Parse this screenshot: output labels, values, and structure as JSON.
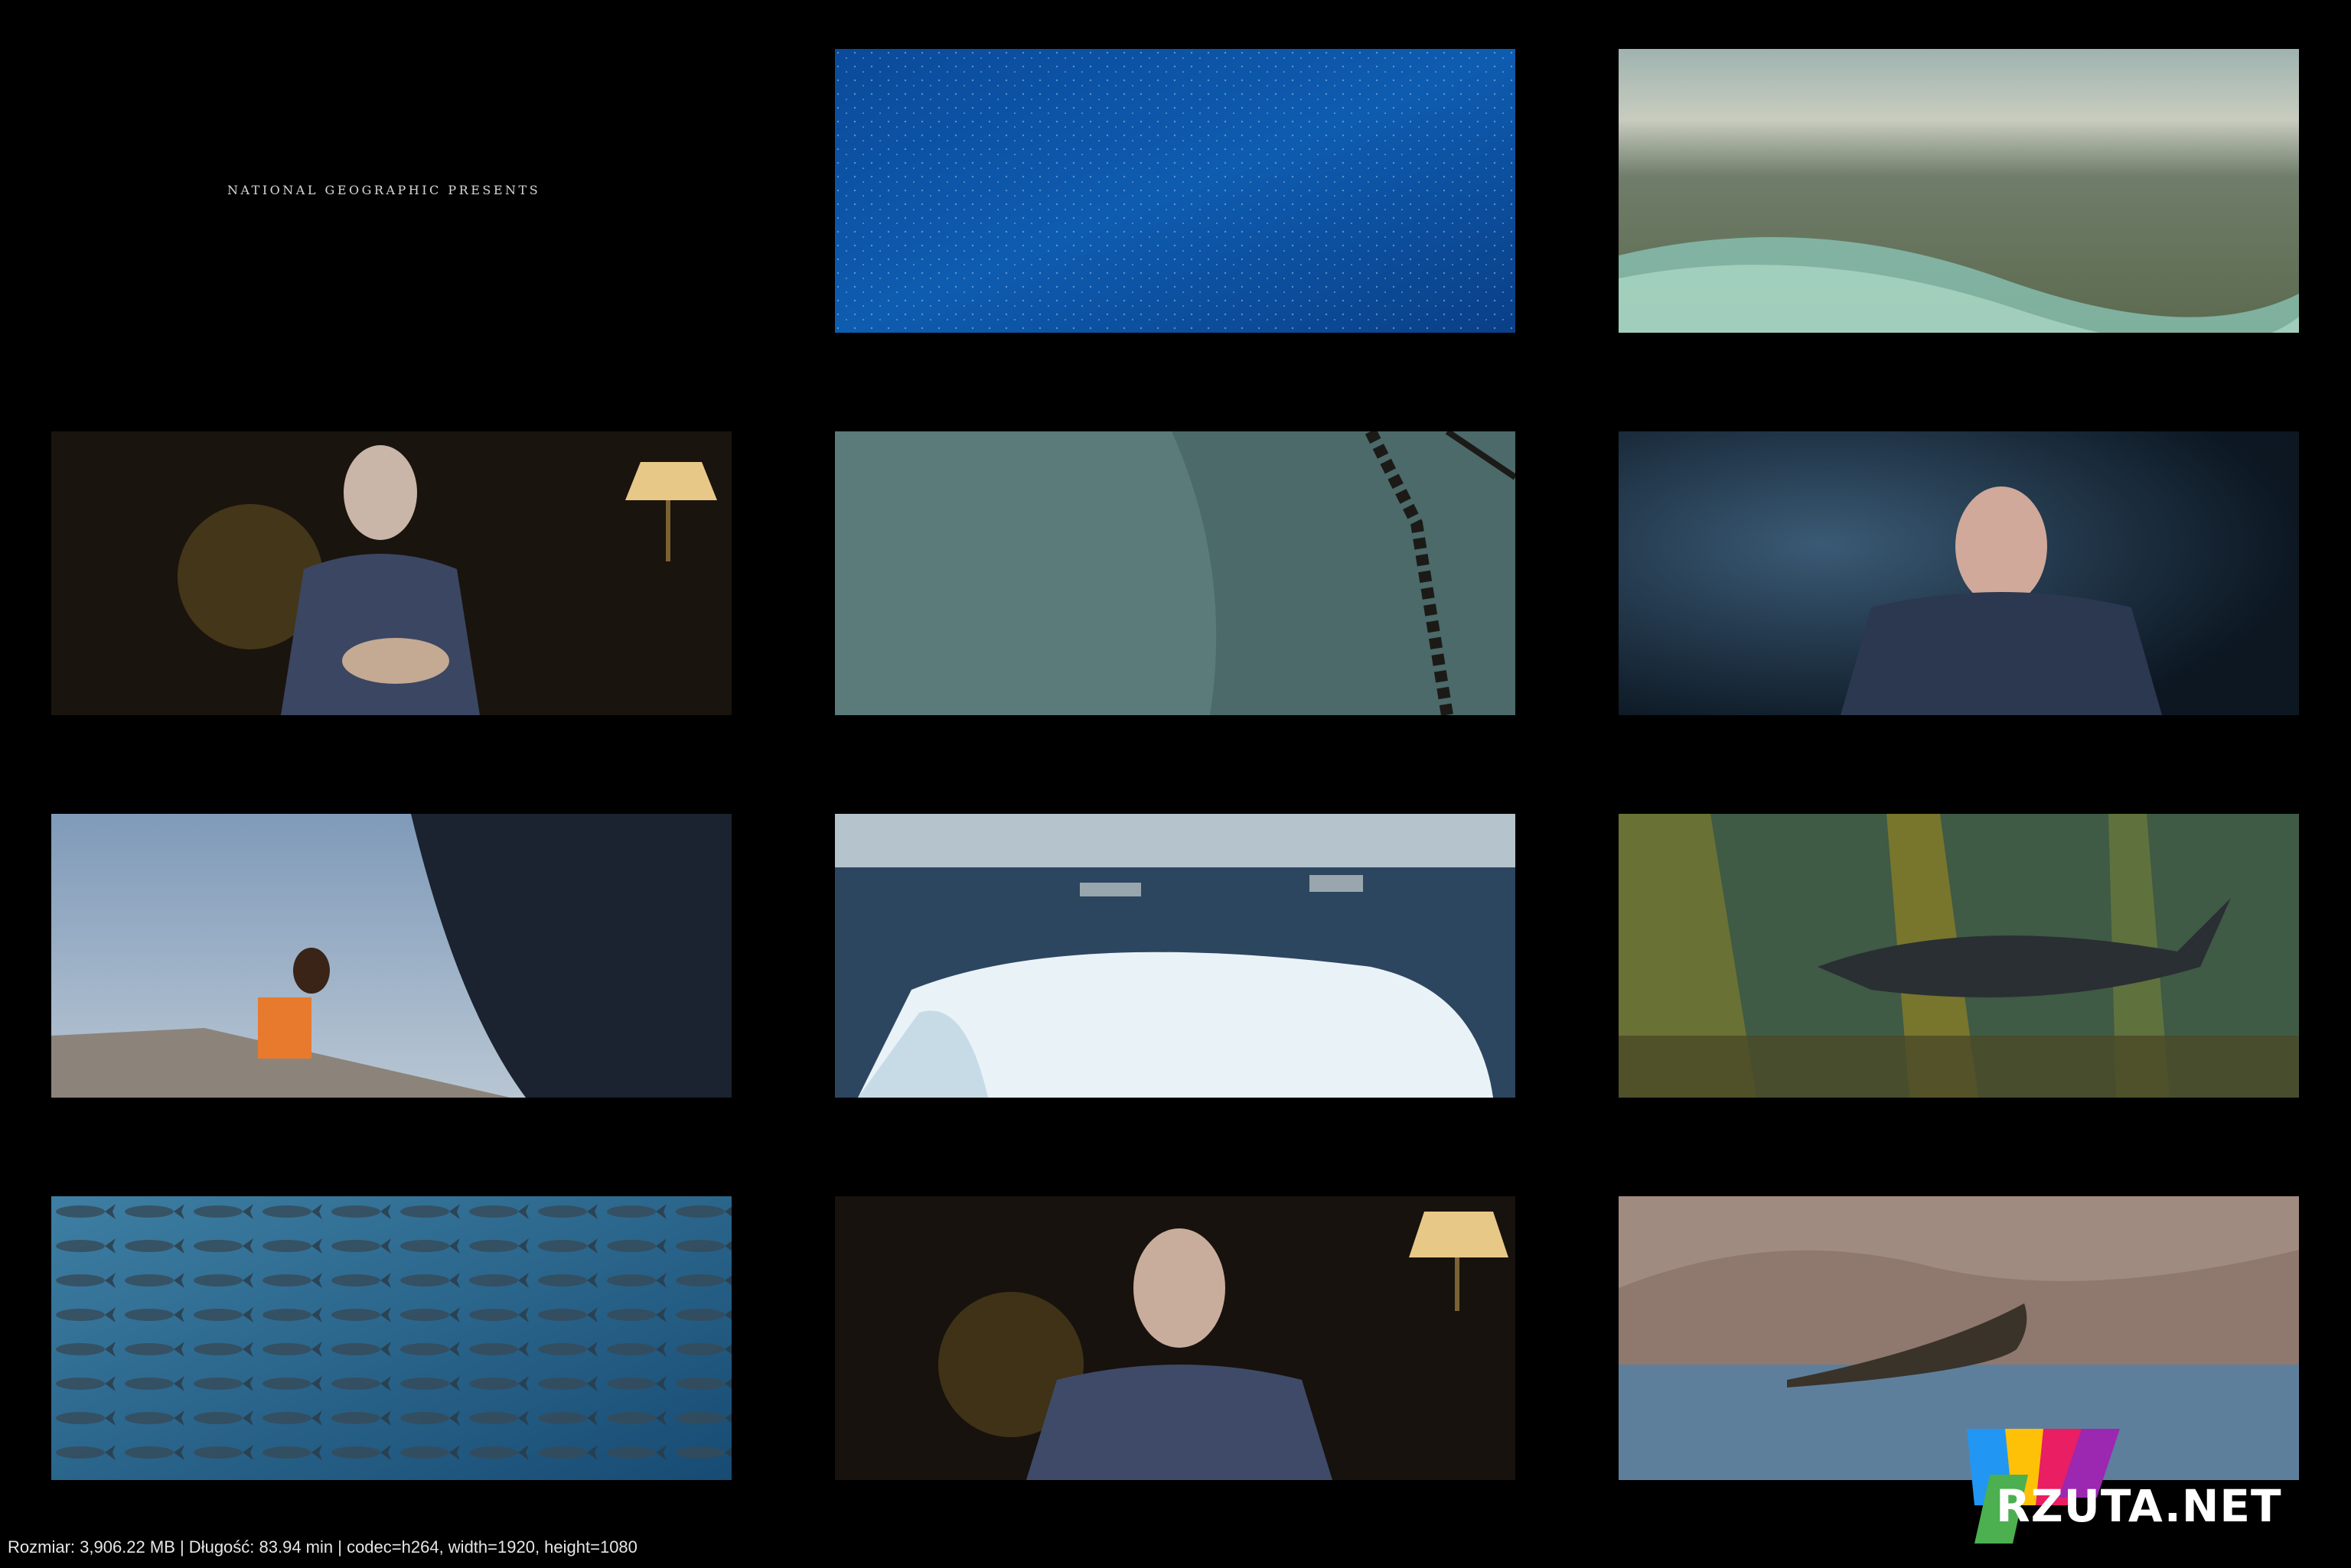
{
  "title_card": {
    "text": "NATIONAL GEOGRAPHIC PRESENTS"
  },
  "thumbnails": [
    {
      "id": "title-card"
    },
    {
      "id": "open-ocean-fish-school"
    },
    {
      "id": "shallow-reef-horizon"
    },
    {
      "id": "narrator-study-globe"
    },
    {
      "id": "seabed-trawl-net"
    },
    {
      "id": "narrator-dark-blue"
    },
    {
      "id": "fisherman-boat-ship"
    },
    {
      "id": "iceberg-penguins-trawlers"
    },
    {
      "id": "kelp-forest-shark"
    },
    {
      "id": "tuna-school"
    },
    {
      "id": "narrator-study-lamp"
    },
    {
      "id": "whale-fluke-mountains"
    }
  ],
  "footer": {
    "text": "Rozmiar: 3,906.22 MB | Długość: 83.94 min | codec=h264, width=1920, height=1080"
  },
  "watermark": {
    "text": "RZUTA.NET",
    "colors": [
      "#2196f3",
      "#ffc107",
      "#e91e63",
      "#4caf50"
    ]
  }
}
